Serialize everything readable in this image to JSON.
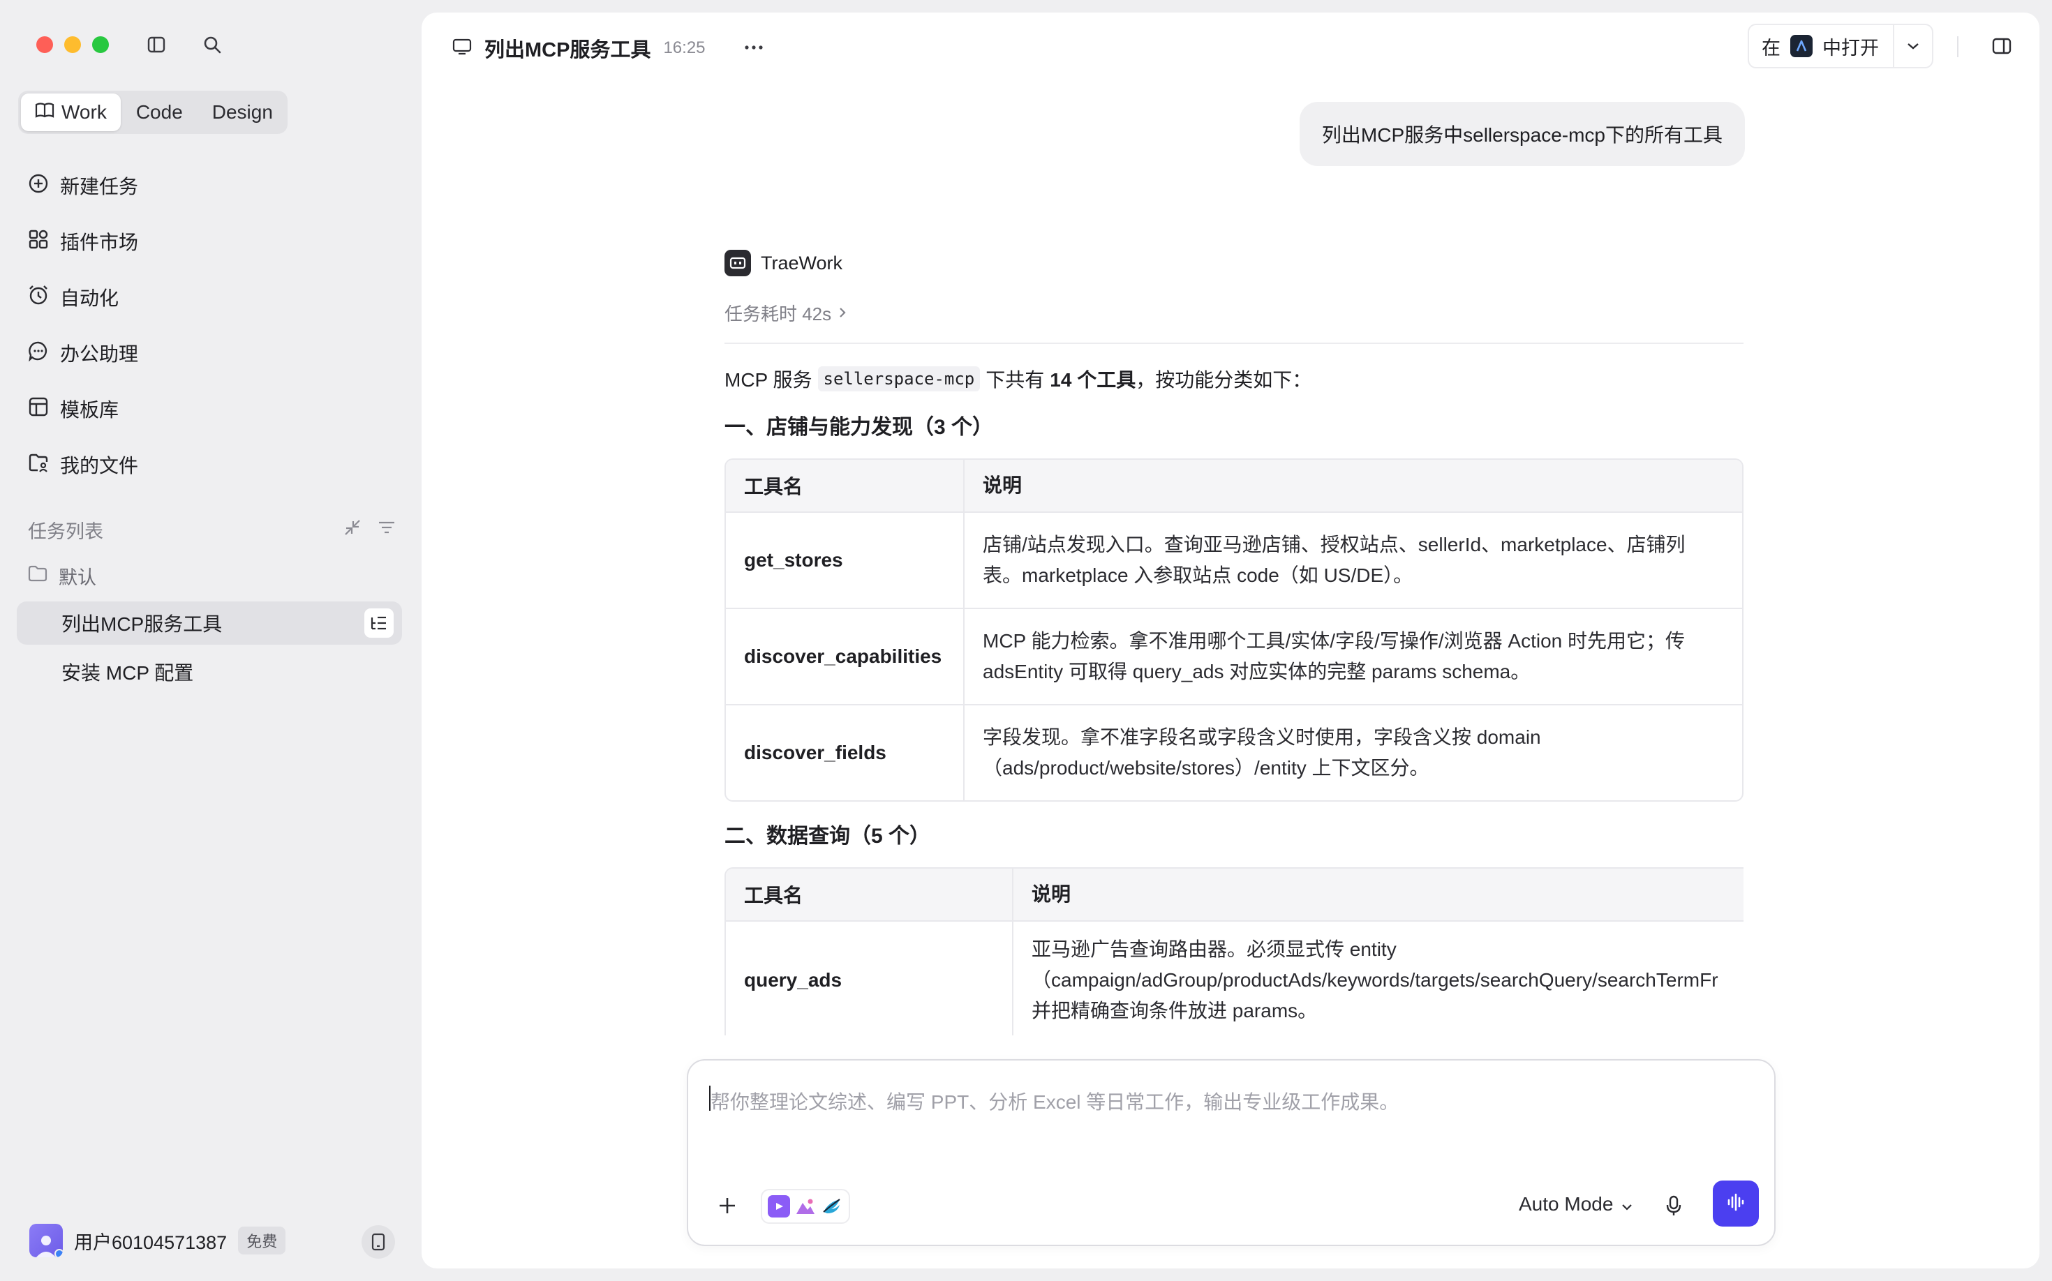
{
  "sidebar": {
    "modes": [
      {
        "label": "Work",
        "active": true
      },
      {
        "label": "Code",
        "active": false
      },
      {
        "label": "Design",
        "active": false
      }
    ],
    "nav": [
      {
        "label": "新建任务",
        "icon": "plus-circle-icon"
      },
      {
        "label": "插件市场",
        "icon": "plugin-grid-icon"
      },
      {
        "label": "自动化",
        "icon": "alarm-clock-icon"
      },
      {
        "label": "办公助理",
        "icon": "chat-bubble-icon"
      },
      {
        "label": "模板库",
        "icon": "template-icon"
      },
      {
        "label": "我的文件",
        "icon": "folder-user-icon"
      }
    ],
    "task_section_label": "任务列表",
    "folder_label": "默认",
    "tasks": [
      {
        "label": "列出MCP服务工具",
        "active": true
      },
      {
        "label": "安装 MCP 配置",
        "active": false
      }
    ],
    "user": {
      "name": "用户60104571387",
      "plan": "免费"
    }
  },
  "header": {
    "title": "列出MCP服务工具",
    "time": "16:25",
    "open_in_prefix": "在",
    "open_in_suffix": "中打开"
  },
  "conversation": {
    "user_message": "列出MCP服务中sellerspace-mcp下的所有工具",
    "agent_name": "TraeWork",
    "duration": "任务耗时 42s",
    "summary": {
      "pre": "MCP 服务",
      "code": "sellerspace-mcp",
      "mid": "下共有",
      "bold": "14 个工具",
      "post": "，按功能分类如下："
    },
    "sections": [
      {
        "heading": "一、店铺与能力发现（3 个）",
        "col_name": "工具名",
        "col_desc": "说明",
        "rows": [
          {
            "name": "get_stores",
            "desc": "店铺/站点发现入口。查询亚马逊店铺、授权站点、sellerId、marketplace、店铺列表。marketplace 入参取站点 code（如 US/DE）。"
          },
          {
            "name": "discover_capabilities",
            "desc": "MCP 能力检索。拿不准用哪个工具/实体/字段/写操作/浏览器 Action 时先用它；传 adsEntity 可取得 query_ads 对应实体的完整 params schema。"
          },
          {
            "name": "discover_fields",
            "desc": "字段发现。拿不准字段名或字段含义时使用，字段含义按 domain（ads/product/website/stores）/entity 上下文区分。"
          }
        ]
      },
      {
        "heading": "二、数据查询（5 个）",
        "col_name": "工具名",
        "col_desc": "说明",
        "rows": [
          {
            "name": "query_ads",
            "desc_lines": [
              "亚马逊广告查询路由器。必须显式传 entity",
              "（campaign/adGroup/productAds/keywords/targets/searchQuery/searchTermFr",
              "并把精确查询条件放进 params。"
            ]
          }
        ]
      }
    ]
  },
  "composer": {
    "placeholder": "帮你整理论文综述、编写 PPT、分析 Excel 等日常工作，输出专业级工作成果。",
    "mode": "Auto Mode"
  },
  "colors": {
    "accent": "#4b3ff0",
    "sidebar_bg": "#efeff1",
    "active_item_bg": "#e1e1e5"
  }
}
